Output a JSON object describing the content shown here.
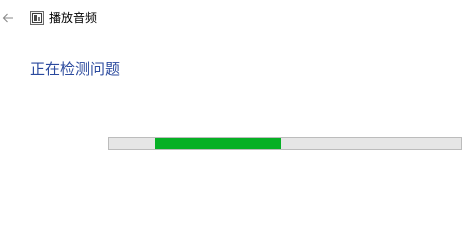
{
  "window": {
    "title": "播放音频"
  },
  "icons": {
    "back": "back-arrow-icon",
    "app": "troubleshooter-icon"
  },
  "main": {
    "status_heading": "正在检测问题"
  },
  "progress": {
    "mode": "indeterminate",
    "fill_start_fraction": 0.13,
    "fill_length_fraction": 0.36
  },
  "colors": {
    "heading": "#2b4a9e",
    "progress_fill": "#06b025",
    "progress_track": "#e6e6e6"
  }
}
